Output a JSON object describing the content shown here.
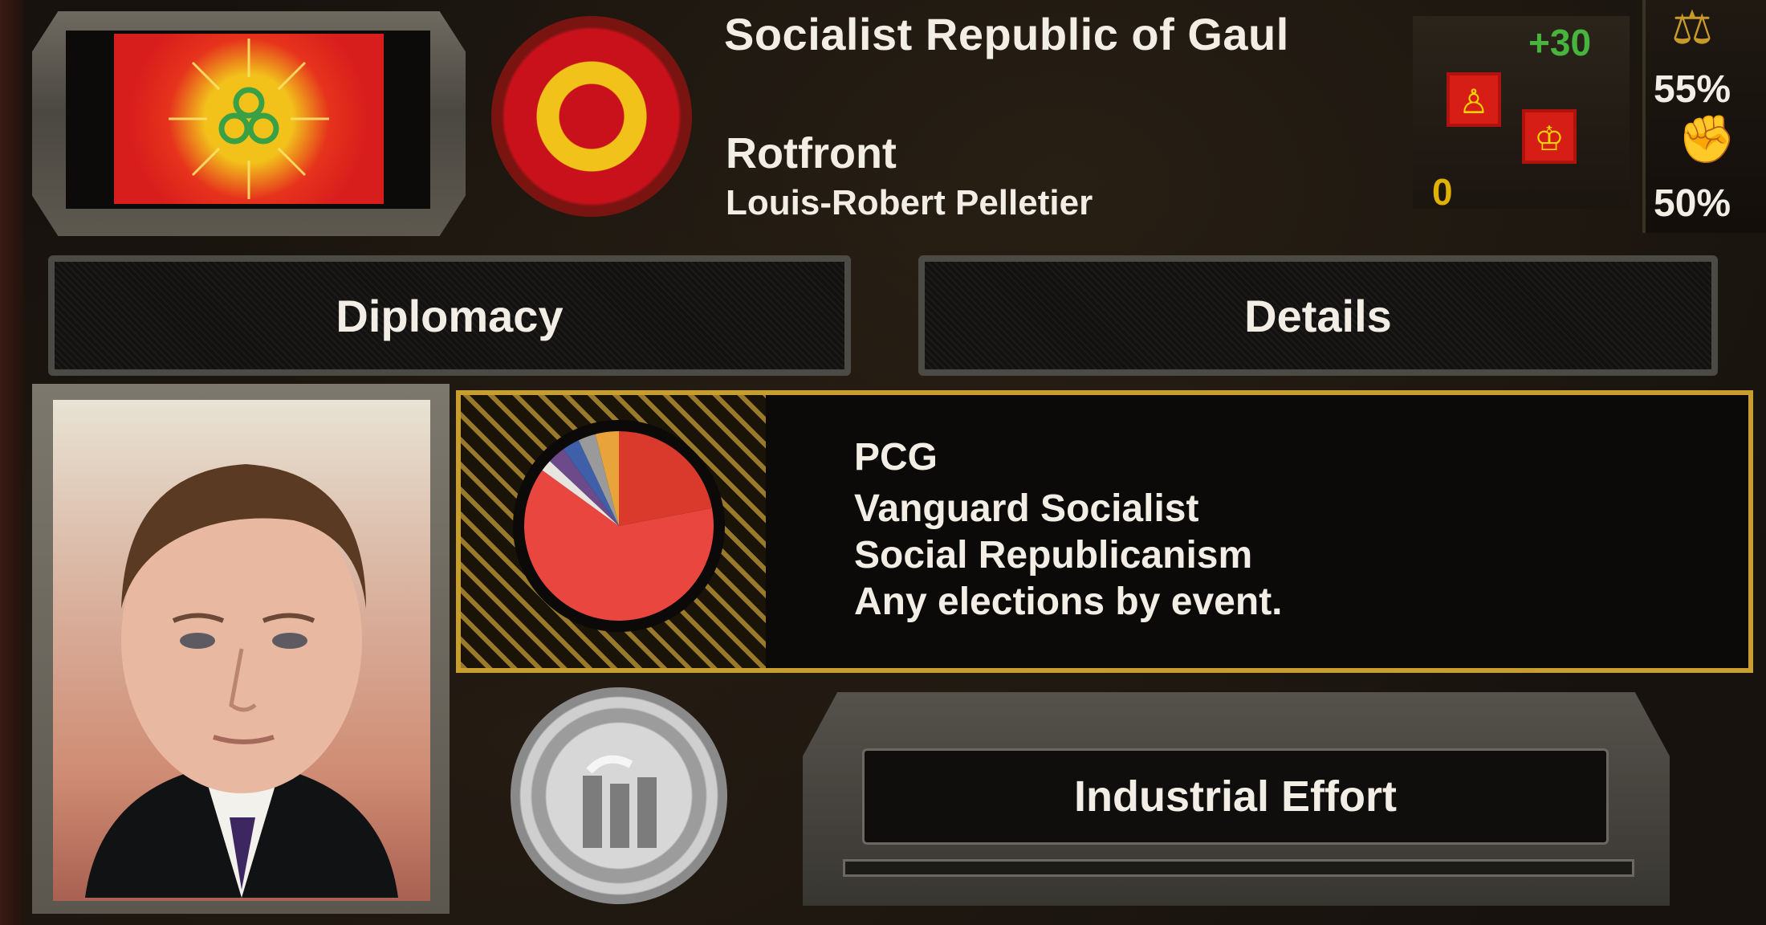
{
  "header": {
    "country_name": "Socialist Republic of Gaul",
    "party_name": "Rotfront",
    "leader_name": "Louis-Robert Pelletier"
  },
  "stability": {
    "plus_value": "+30",
    "zero_value": "0",
    "support_pct": "55%",
    "war_support_pct": "50%"
  },
  "tabs": {
    "diplomacy": "Diplomacy",
    "details": "Details"
  },
  "party": {
    "short_name": "PCG",
    "ideology": "Vanguard Socialist",
    "government_type": "Social Republicanism",
    "election_rule": "Any elections by event."
  },
  "industry": {
    "button_label": "Industrial Effort"
  },
  "pie_data": {
    "type": "pie",
    "slices": [
      {
        "color": "#d93a2c",
        "value": 0.22
      },
      {
        "color": "#e94640",
        "value": 0.63
      },
      {
        "color": "#e8e5e1",
        "value": 0.02
      },
      {
        "color": "#6d4a89",
        "value": 0.03
      },
      {
        "color": "#3f5fa8",
        "value": 0.03
      },
      {
        "color": "#9a9a9a",
        "value": 0.03
      },
      {
        "color": "#e8a33a",
        "value": 0.04
      }
    ]
  },
  "colors": {
    "accent_gold": "#c89e30",
    "flag_red": "#d81d1d",
    "flag_yellow": "#f2c21b",
    "positive_green": "#47b43e"
  },
  "icons": {
    "support": "scales-icon",
    "war_support": "gear-helmet-icon"
  }
}
